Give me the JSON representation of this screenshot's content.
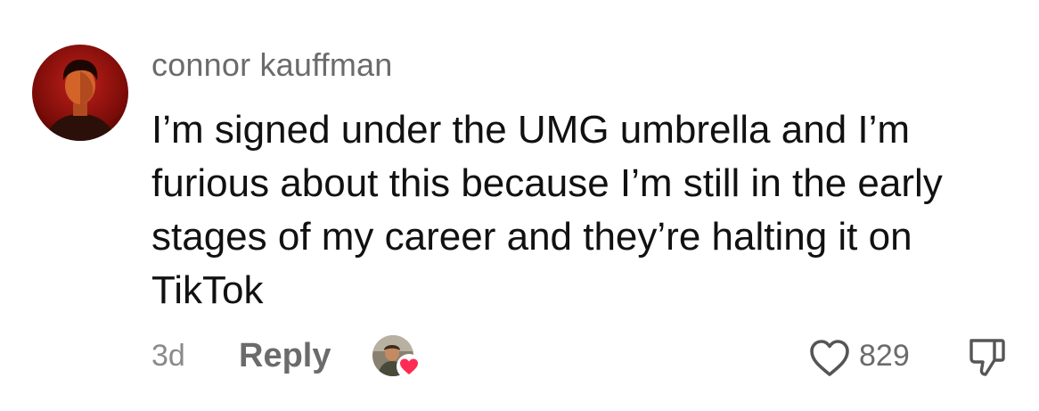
{
  "comment": {
    "username": "connor kauffman",
    "text": "I’m signed under the UMG umbrella and I’m furious about this because I’m still in the early stages of my career and they’re halting it on TikTok",
    "time": "3d",
    "reply_label": "Reply",
    "like_count": "829",
    "icons": {
      "avatar": "user-avatar",
      "creator_liked": "creator-avatar-heart-icon",
      "like": "heart-outline-icon",
      "dislike": "thumbs-down-icon"
    },
    "colors": {
      "heart_badge": "#fe2c55",
      "meta_text": "#6b6b6b"
    }
  }
}
